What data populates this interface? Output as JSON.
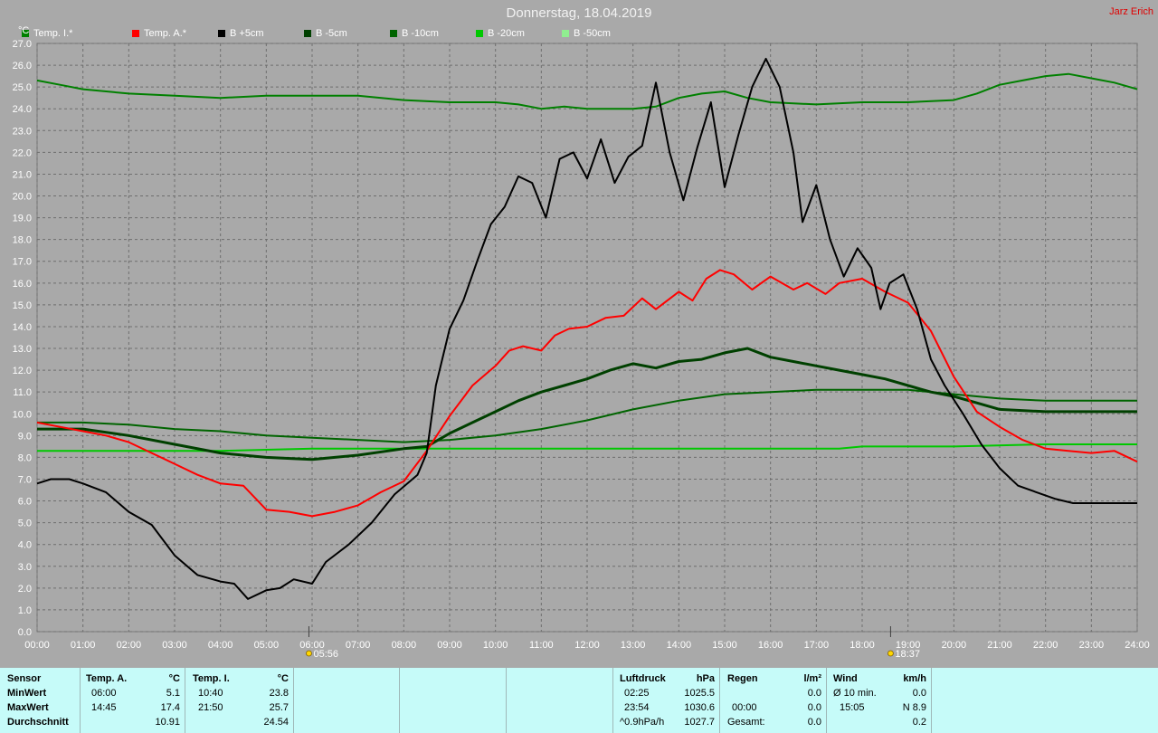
{
  "title": "Donnerstag, 18.04.2019",
  "author": "Jarz Erich",
  "chart_data": {
    "type": "line",
    "ylabel": "°C",
    "ylim": [
      0,
      27
    ],
    "yticks": [
      "0.0",
      "1.0",
      "2.0",
      "3.0",
      "4.0",
      "5.0",
      "6.0",
      "7.0",
      "8.0",
      "9.0",
      "10.0",
      "11.0",
      "12.0",
      "13.0",
      "14.0",
      "15.0",
      "16.0",
      "17.0",
      "18.0",
      "19.0",
      "20.0",
      "21.0",
      "22.0",
      "23.0",
      "24.0",
      "25.0",
      "26.0",
      "27.0"
    ],
    "xticks": [
      "00:00",
      "01:00",
      "02:00",
      "03:00",
      "04:00",
      "05:00",
      "06:00",
      "07:00",
      "08:00",
      "09:00",
      "10:00",
      "11:00",
      "12:00",
      "13:00",
      "14:00",
      "15:00",
      "16:00",
      "17:00",
      "18:00",
      "19:00",
      "20:00",
      "21:00",
      "22:00",
      "23:00",
      "24:00"
    ],
    "xlim": [
      0,
      24
    ],
    "grid": true,
    "legend_position": "top-left",
    "markers": [
      {
        "label": "05:56",
        "x": 5.93
      },
      {
        "label": "18:37",
        "x": 18.62
      }
    ],
    "series": [
      {
        "name": "Temp. I.*",
        "color": "#008000",
        "points": [
          [
            0,
            25.3
          ],
          [
            0.5,
            25.1
          ],
          [
            1,
            24.9
          ],
          [
            2,
            24.7
          ],
          [
            3,
            24.6
          ],
          [
            4,
            24.5
          ],
          [
            5,
            24.6
          ],
          [
            6,
            24.6
          ],
          [
            7,
            24.6
          ],
          [
            8,
            24.4
          ],
          [
            9,
            24.3
          ],
          [
            10,
            24.3
          ],
          [
            10.5,
            24.2
          ],
          [
            11,
            24.0
          ],
          [
            11.5,
            24.1
          ],
          [
            12,
            24.0
          ],
          [
            13,
            24.0
          ],
          [
            13.5,
            24.1
          ],
          [
            14,
            24.5
          ],
          [
            14.5,
            24.7
          ],
          [
            15,
            24.8
          ],
          [
            15.5,
            24.5
          ],
          [
            16,
            24.3
          ],
          [
            17,
            24.2
          ],
          [
            18,
            24.3
          ],
          [
            19,
            24.3
          ],
          [
            20,
            24.4
          ],
          [
            20.5,
            24.7
          ],
          [
            21,
            25.1
          ],
          [
            21.5,
            25.3
          ],
          [
            22,
            25.5
          ],
          [
            22.5,
            25.6
          ],
          [
            23,
            25.4
          ],
          [
            23.5,
            25.2
          ],
          [
            24,
            24.9
          ]
        ]
      },
      {
        "name": "Temp. A.*",
        "color": "#ff0000",
        "points": [
          [
            0,
            9.6
          ],
          [
            0.5,
            9.4
          ],
          [
            1,
            9.2
          ],
          [
            1.5,
            9.0
          ],
          [
            2,
            8.7
          ],
          [
            2.5,
            8.2
          ],
          [
            3,
            7.7
          ],
          [
            3.5,
            7.2
          ],
          [
            4,
            6.8
          ],
          [
            4.5,
            6.7
          ],
          [
            5,
            5.6
          ],
          [
            5.5,
            5.5
          ],
          [
            6,
            5.3
          ],
          [
            6.5,
            5.5
          ],
          [
            7,
            5.8
          ],
          [
            7.5,
            6.4
          ],
          [
            8,
            6.9
          ],
          [
            8.5,
            8.3
          ],
          [
            9,
            9.9
          ],
          [
            9.5,
            11.3
          ],
          [
            10,
            12.2
          ],
          [
            10.3,
            12.9
          ],
          [
            10.6,
            13.1
          ],
          [
            11,
            12.9
          ],
          [
            11.3,
            13.6
          ],
          [
            11.6,
            13.9
          ],
          [
            12,
            14.0
          ],
          [
            12.4,
            14.4
          ],
          [
            12.8,
            14.5
          ],
          [
            13.2,
            15.3
          ],
          [
            13.5,
            14.8
          ],
          [
            14,
            15.6
          ],
          [
            14.3,
            15.2
          ],
          [
            14.6,
            16.2
          ],
          [
            14.9,
            16.6
          ],
          [
            15.2,
            16.4
          ],
          [
            15.6,
            15.7
          ],
          [
            16,
            16.3
          ],
          [
            16.5,
            15.7
          ],
          [
            16.8,
            16.0
          ],
          [
            17.2,
            15.5
          ],
          [
            17.5,
            16.0
          ],
          [
            18,
            16.2
          ],
          [
            18.5,
            15.6
          ],
          [
            19,
            15.1
          ],
          [
            19.5,
            13.8
          ],
          [
            20,
            11.7
          ],
          [
            20.5,
            10.1
          ],
          [
            21,
            9.4
          ],
          [
            21.5,
            8.8
          ],
          [
            22,
            8.4
          ],
          [
            22.5,
            8.3
          ],
          [
            23,
            8.2
          ],
          [
            23.5,
            8.3
          ],
          [
            24,
            7.8
          ]
        ]
      },
      {
        "name": "B +5cm",
        "color": "#000000",
        "points": [
          [
            0,
            6.8
          ],
          [
            0.3,
            7.0
          ],
          [
            0.7,
            7.0
          ],
          [
            1,
            6.8
          ],
          [
            1.5,
            6.4
          ],
          [
            2,
            5.5
          ],
          [
            2.5,
            4.9
          ],
          [
            3,
            3.5
          ],
          [
            3.5,
            2.6
          ],
          [
            4,
            2.3
          ],
          [
            4.3,
            2.2
          ],
          [
            4.6,
            1.5
          ],
          [
            5,
            1.9
          ],
          [
            5.3,
            2.0
          ],
          [
            5.6,
            2.4
          ],
          [
            6,
            2.2
          ],
          [
            6.3,
            3.2
          ],
          [
            6.8,
            4.0
          ],
          [
            7.3,
            5.0
          ],
          [
            7.8,
            6.3
          ],
          [
            8.3,
            7.2
          ],
          [
            8.5,
            8.2
          ],
          [
            8.7,
            11.3
          ],
          [
            9,
            13.9
          ],
          [
            9.3,
            15.2
          ],
          [
            9.6,
            17.0
          ],
          [
            9.9,
            18.7
          ],
          [
            10.2,
            19.5
          ],
          [
            10.5,
            20.9
          ],
          [
            10.8,
            20.6
          ],
          [
            11.1,
            19.0
          ],
          [
            11.4,
            21.7
          ],
          [
            11.7,
            22.0
          ],
          [
            12,
            20.8
          ],
          [
            12.3,
            22.6
          ],
          [
            12.6,
            20.6
          ],
          [
            12.9,
            21.8
          ],
          [
            13.2,
            22.3
          ],
          [
            13.5,
            25.2
          ],
          [
            13.8,
            22.0
          ],
          [
            14.1,
            19.8
          ],
          [
            14.4,
            22.2
          ],
          [
            14.7,
            24.3
          ],
          [
            15,
            20.4
          ],
          [
            15.3,
            22.8
          ],
          [
            15.6,
            25.0
          ],
          [
            15.9,
            26.3
          ],
          [
            16.2,
            25.0
          ],
          [
            16.5,
            22.0
          ],
          [
            16.7,
            18.8
          ],
          [
            17,
            20.5
          ],
          [
            17.3,
            18.0
          ],
          [
            17.6,
            16.3
          ],
          [
            17.9,
            17.6
          ],
          [
            18.2,
            16.7
          ],
          [
            18.4,
            14.8
          ],
          [
            18.6,
            16.0
          ],
          [
            18.9,
            16.4
          ],
          [
            19.2,
            14.8
          ],
          [
            19.5,
            12.5
          ],
          [
            19.8,
            11.3
          ],
          [
            20.2,
            10.0
          ],
          [
            20.6,
            8.6
          ],
          [
            21,
            7.5
          ],
          [
            21.4,
            6.7
          ],
          [
            21.8,
            6.4
          ],
          [
            22.2,
            6.1
          ],
          [
            22.6,
            5.9
          ],
          [
            23,
            5.9
          ],
          [
            23.5,
            5.9
          ],
          [
            24,
            5.9
          ]
        ]
      },
      {
        "name": "B -5cm",
        "color": "#004000",
        "points": [
          [
            0,
            9.3
          ],
          [
            1,
            9.3
          ],
          [
            2,
            9.0
          ],
          [
            3,
            8.6
          ],
          [
            4,
            8.2
          ],
          [
            5,
            8.0
          ],
          [
            6,
            7.9
          ],
          [
            7,
            8.1
          ],
          [
            8,
            8.4
          ],
          [
            8.5,
            8.5
          ],
          [
            9,
            9.1
          ],
          [
            9.5,
            9.6
          ],
          [
            10,
            10.1
          ],
          [
            10.5,
            10.6
          ],
          [
            11,
            11.0
          ],
          [
            11.5,
            11.3
          ],
          [
            12,
            11.6
          ],
          [
            12.5,
            12.0
          ],
          [
            13,
            12.3
          ],
          [
            13.5,
            12.1
          ],
          [
            14,
            12.4
          ],
          [
            14.5,
            12.5
          ],
          [
            15,
            12.8
          ],
          [
            15.5,
            13.0
          ],
          [
            16,
            12.6
          ],
          [
            16.5,
            12.4
          ],
          [
            17,
            12.2
          ],
          [
            17.5,
            12.0
          ],
          [
            18,
            11.8
          ],
          [
            18.5,
            11.6
          ],
          [
            19,
            11.3
          ],
          [
            19.5,
            11.0
          ],
          [
            20,
            10.8
          ],
          [
            20.5,
            10.5
          ],
          [
            21,
            10.2
          ],
          [
            22,
            10.1
          ],
          [
            23,
            10.1
          ],
          [
            24,
            10.1
          ]
        ]
      },
      {
        "name": "B -10cm",
        "color": "#006400",
        "points": [
          [
            0,
            9.6
          ],
          [
            1,
            9.6
          ],
          [
            2,
            9.5
          ],
          [
            3,
            9.3
          ],
          [
            4,
            9.2
          ],
          [
            5,
            9.0
          ],
          [
            6,
            8.9
          ],
          [
            7,
            8.8
          ],
          [
            8,
            8.7
          ],
          [
            9,
            8.8
          ],
          [
            10,
            9.0
          ],
          [
            11,
            9.3
          ],
          [
            12,
            9.7
          ],
          [
            13,
            10.2
          ],
          [
            14,
            10.6
          ],
          [
            15,
            10.9
          ],
          [
            16,
            11.0
          ],
          [
            17,
            11.1
          ],
          [
            18,
            11.1
          ],
          [
            19,
            11.1
          ],
          [
            20,
            10.9
          ],
          [
            21,
            10.7
          ],
          [
            22,
            10.6
          ],
          [
            23,
            10.6
          ],
          [
            24,
            10.6
          ]
        ]
      },
      {
        "name": "B -20cm",
        "color": "#00c800",
        "points": [
          [
            0,
            8.3
          ],
          [
            2,
            8.3
          ],
          [
            4,
            8.3
          ],
          [
            6,
            8.4
          ],
          [
            8,
            8.4
          ],
          [
            10,
            8.4
          ],
          [
            12,
            8.4
          ],
          [
            14,
            8.4
          ],
          [
            16,
            8.4
          ],
          [
            17.5,
            8.4
          ],
          [
            18,
            8.5
          ],
          [
            20,
            8.5
          ],
          [
            22,
            8.6
          ],
          [
            24,
            8.6
          ]
        ]
      },
      {
        "name": "B -50cm",
        "color": "#90ee90",
        "points": []
      }
    ]
  },
  "stats": {
    "sensor": {
      "header": "Sensor",
      "rows": [
        "MinWert",
        "MaxWert",
        "Durchschnitt"
      ]
    },
    "temp_a": {
      "header": "Temp. A.",
      "unit": "°C",
      "min_time": "06:00",
      "min": "5.1",
      "max_time": "14:45",
      "max": "17.4",
      "avg": "10.91"
    },
    "temp_i": {
      "header": "Temp. I.",
      "unit": "°C",
      "min_time": "10:40",
      "min": "23.8",
      "max_time": "21:50",
      "max": "25.7",
      "avg": "24.54"
    },
    "pressure": {
      "header": "Luftdruck",
      "unit": "hPa",
      "r1_label": "02:25",
      "r1_value": "1025.5",
      "r2_label": "23:54",
      "r2_value": "1030.6",
      "r3_label": "^0.9hPa/h",
      "r3_value": "1027.7"
    },
    "rain": {
      "header": "Regen",
      "unit": "l/m²",
      "r2_label": "00:00",
      "r2_value": "0.0",
      "r3_label": "Gesamt:",
      "r3_value": "0.0",
      "r1_value": "0.0"
    },
    "wind": {
      "header": "Wind",
      "unit": "km/h",
      "r1_label": "Ø 10 min.",
      "r1_value": "0.0",
      "r2_label": "15:05",
      "r2_value": "N 8.9",
      "r3_value": "0.2"
    }
  }
}
